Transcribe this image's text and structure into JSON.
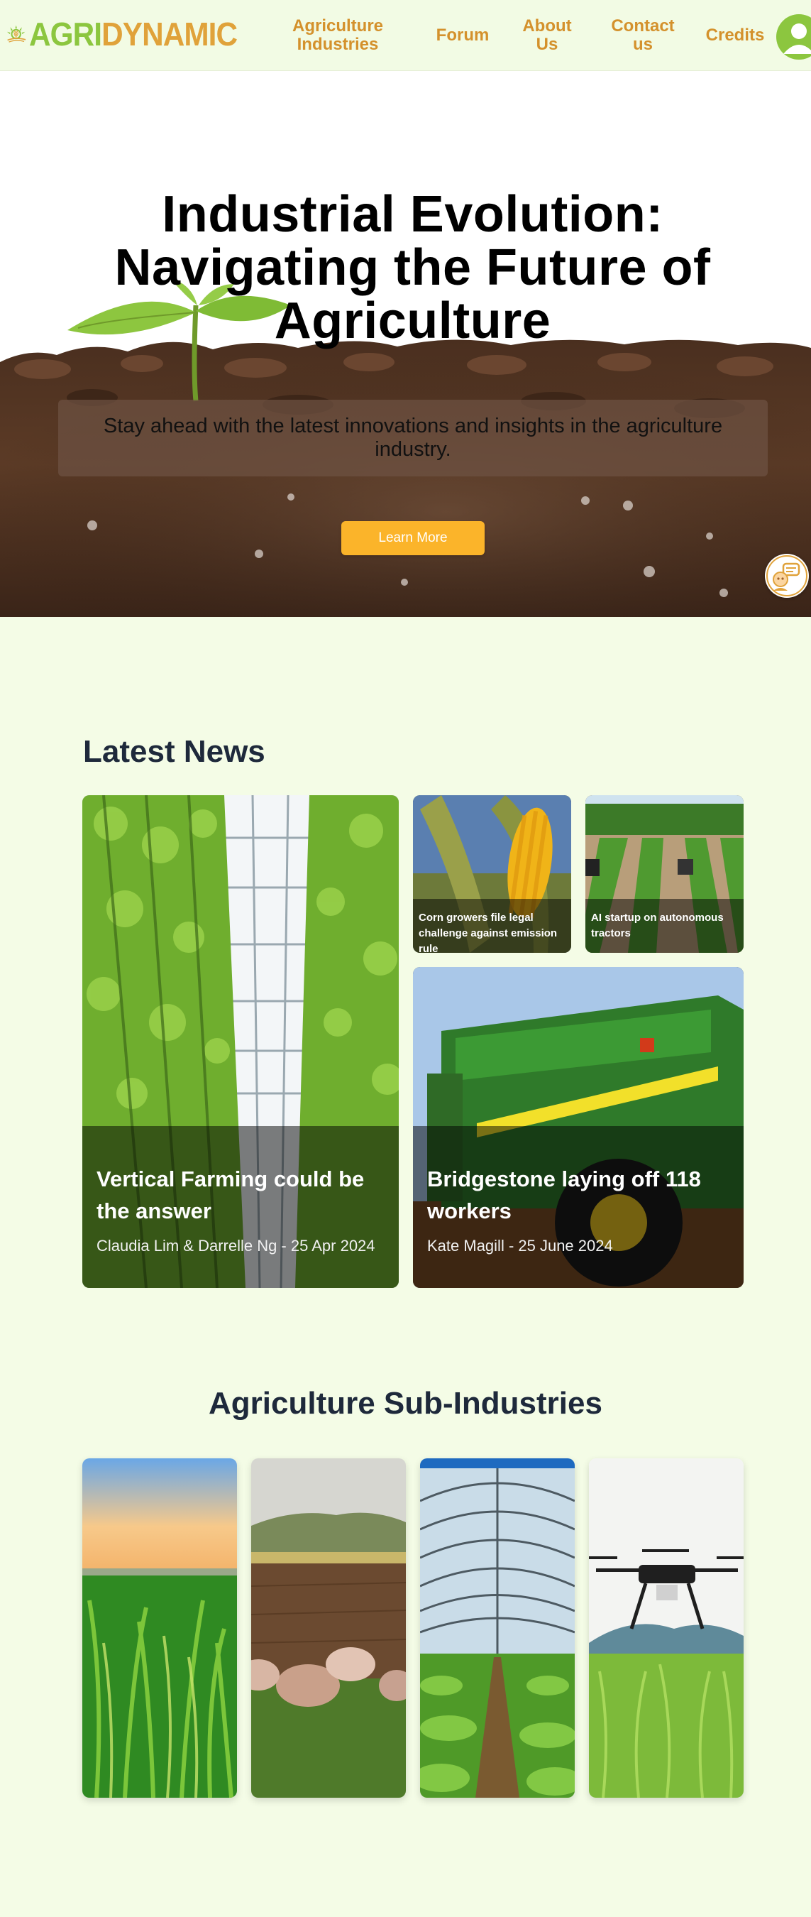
{
  "brand": {
    "name_part1": "Agri",
    "name_part2": "Dynamic"
  },
  "nav": {
    "items": [
      {
        "label": "Agriculture Industries"
      },
      {
        "label": "Forum"
      },
      {
        "label": "About Us"
      },
      {
        "label": "Contact us"
      },
      {
        "label": "Credits"
      }
    ],
    "profile_icon": "user-avatar-icon"
  },
  "hero": {
    "title": "Industrial Evolution: Navigating the Future of Agriculture",
    "subtitle": "Stay ahead with the latest innovations and insights in the agriculture industry.",
    "button_label": "Learn More",
    "chat_icon": "chatbot-icon"
  },
  "latest_news": {
    "heading": "Latest News",
    "featured": [
      {
        "title": "Vertical Farming could be the answer",
        "meta": "Claudia Lim & Darrelle Ng - 25 Apr 2024"
      },
      {
        "title": "Bridgestone laying off 118 workers",
        "meta": "Kate Magill - 25 June 2024"
      }
    ],
    "small": [
      {
        "title": "Corn growers file legal challenge against emission rule"
      },
      {
        "title": "AI startup on autonomous tractors"
      }
    ]
  },
  "sub_industries": {
    "heading": "Agriculture Sub-Industries",
    "cards": [
      {
        "image": "corn-field"
      },
      {
        "image": "livestock-pigs"
      },
      {
        "image": "greenhouse"
      },
      {
        "image": "farm-drone"
      }
    ]
  },
  "colors": {
    "brand_green": "#8cc63f",
    "brand_orange": "#e0a23a",
    "nav_link": "#d4912c",
    "button": "#fbb42a",
    "page_bg": "#f4fce6",
    "heading": "#1e293b"
  }
}
